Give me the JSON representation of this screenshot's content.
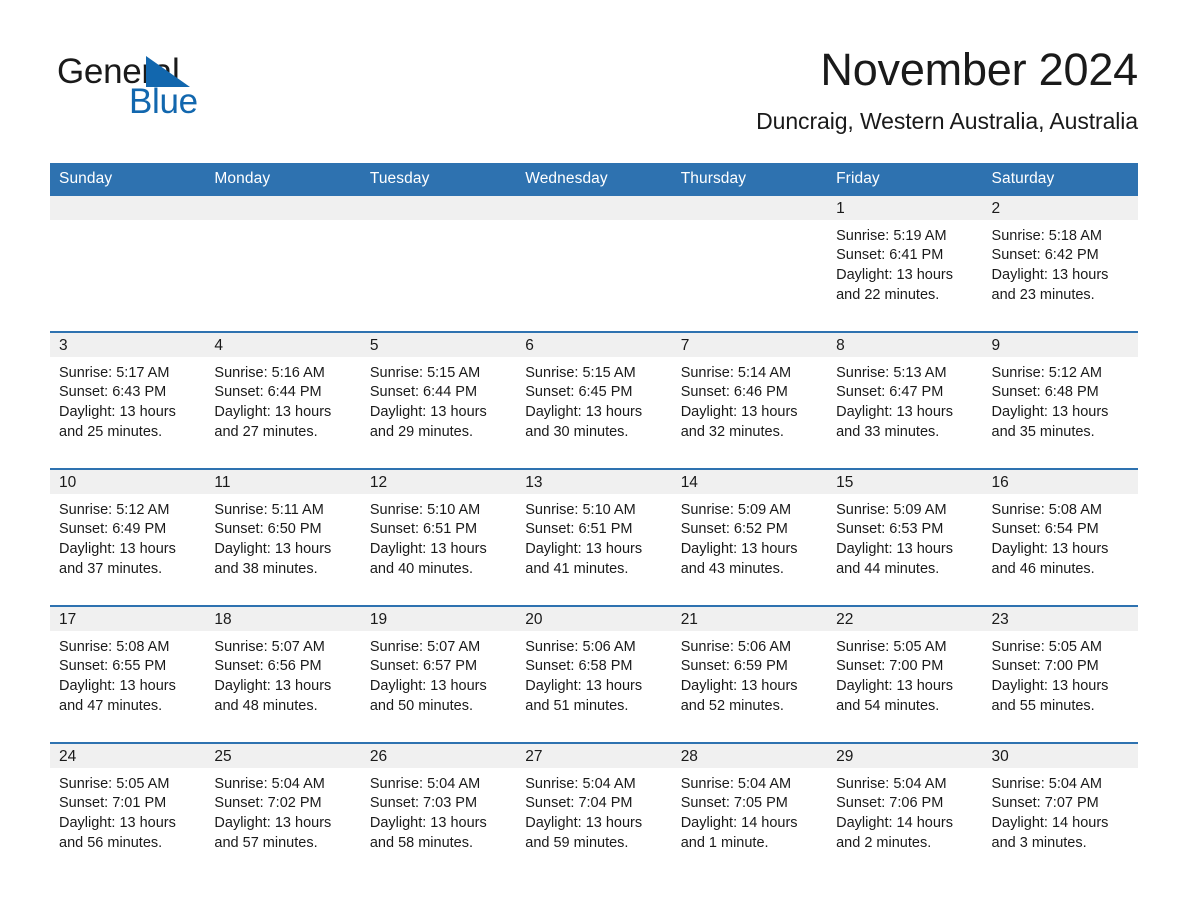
{
  "brand": {
    "word_one": "General",
    "word_two": "Blue",
    "triangle_icon": "triangle-logo-icon",
    "color": "#1267ae"
  },
  "header": {
    "month_title": "November 2024",
    "location": "Duncraig, Western Australia, Australia"
  },
  "theme": {
    "header_blue": "#2e72b0",
    "daynum_band": "#f0f0f0",
    "text": "#1a1a1a"
  },
  "calendar": {
    "weekday_headers": [
      "Sunday",
      "Monday",
      "Tuesday",
      "Wednesday",
      "Thursday",
      "Friday",
      "Saturday"
    ],
    "weeks": [
      [
        {
          "day": "",
          "empty": true
        },
        {
          "day": "",
          "empty": true
        },
        {
          "day": "",
          "empty": true
        },
        {
          "day": "",
          "empty": true
        },
        {
          "day": "",
          "empty": true
        },
        {
          "day": "1",
          "sunrise": "Sunrise: 5:19 AM",
          "sunset": "Sunset: 6:41 PM",
          "daylight": "Daylight: 13 hours and 22 minutes."
        },
        {
          "day": "2",
          "sunrise": "Sunrise: 5:18 AM",
          "sunset": "Sunset: 6:42 PM",
          "daylight": "Daylight: 13 hours and 23 minutes."
        }
      ],
      [
        {
          "day": "3",
          "sunrise": "Sunrise: 5:17 AM",
          "sunset": "Sunset: 6:43 PM",
          "daylight": "Daylight: 13 hours and 25 minutes."
        },
        {
          "day": "4",
          "sunrise": "Sunrise: 5:16 AM",
          "sunset": "Sunset: 6:44 PM",
          "daylight": "Daylight: 13 hours and 27 minutes."
        },
        {
          "day": "5",
          "sunrise": "Sunrise: 5:15 AM",
          "sunset": "Sunset: 6:44 PM",
          "daylight": "Daylight: 13 hours and 29 minutes."
        },
        {
          "day": "6",
          "sunrise": "Sunrise: 5:15 AM",
          "sunset": "Sunset: 6:45 PM",
          "daylight": "Daylight: 13 hours and 30 minutes."
        },
        {
          "day": "7",
          "sunrise": "Sunrise: 5:14 AM",
          "sunset": "Sunset: 6:46 PM",
          "daylight": "Daylight: 13 hours and 32 minutes."
        },
        {
          "day": "8",
          "sunrise": "Sunrise: 5:13 AM",
          "sunset": "Sunset: 6:47 PM",
          "daylight": "Daylight: 13 hours and 33 minutes."
        },
        {
          "day": "9",
          "sunrise": "Sunrise: 5:12 AM",
          "sunset": "Sunset: 6:48 PM",
          "daylight": "Daylight: 13 hours and 35 minutes."
        }
      ],
      [
        {
          "day": "10",
          "sunrise": "Sunrise: 5:12 AM",
          "sunset": "Sunset: 6:49 PM",
          "daylight": "Daylight: 13 hours and 37 minutes."
        },
        {
          "day": "11",
          "sunrise": "Sunrise: 5:11 AM",
          "sunset": "Sunset: 6:50 PM",
          "daylight": "Daylight: 13 hours and 38 minutes."
        },
        {
          "day": "12",
          "sunrise": "Sunrise: 5:10 AM",
          "sunset": "Sunset: 6:51 PM",
          "daylight": "Daylight: 13 hours and 40 minutes."
        },
        {
          "day": "13",
          "sunrise": "Sunrise: 5:10 AM",
          "sunset": "Sunset: 6:51 PM",
          "daylight": "Daylight: 13 hours and 41 minutes."
        },
        {
          "day": "14",
          "sunrise": "Sunrise: 5:09 AM",
          "sunset": "Sunset: 6:52 PM",
          "daylight": "Daylight: 13 hours and 43 minutes."
        },
        {
          "day": "15",
          "sunrise": "Sunrise: 5:09 AM",
          "sunset": "Sunset: 6:53 PM",
          "daylight": "Daylight: 13 hours and 44 minutes."
        },
        {
          "day": "16",
          "sunrise": "Sunrise: 5:08 AM",
          "sunset": "Sunset: 6:54 PM",
          "daylight": "Daylight: 13 hours and 46 minutes."
        }
      ],
      [
        {
          "day": "17",
          "sunrise": "Sunrise: 5:08 AM",
          "sunset": "Sunset: 6:55 PM",
          "daylight": "Daylight: 13 hours and 47 minutes."
        },
        {
          "day": "18",
          "sunrise": "Sunrise: 5:07 AM",
          "sunset": "Sunset: 6:56 PM",
          "daylight": "Daylight: 13 hours and 48 minutes."
        },
        {
          "day": "19",
          "sunrise": "Sunrise: 5:07 AM",
          "sunset": "Sunset: 6:57 PM",
          "daylight": "Daylight: 13 hours and 50 minutes."
        },
        {
          "day": "20",
          "sunrise": "Sunrise: 5:06 AM",
          "sunset": "Sunset: 6:58 PM",
          "daylight": "Daylight: 13 hours and 51 minutes."
        },
        {
          "day": "21",
          "sunrise": "Sunrise: 5:06 AM",
          "sunset": "Sunset: 6:59 PM",
          "daylight": "Daylight: 13 hours and 52 minutes."
        },
        {
          "day": "22",
          "sunrise": "Sunrise: 5:05 AM",
          "sunset": "Sunset: 7:00 PM",
          "daylight": "Daylight: 13 hours and 54 minutes."
        },
        {
          "day": "23",
          "sunrise": "Sunrise: 5:05 AM",
          "sunset": "Sunset: 7:00 PM",
          "daylight": "Daylight: 13 hours and 55 minutes."
        }
      ],
      [
        {
          "day": "24",
          "sunrise": "Sunrise: 5:05 AM",
          "sunset": "Sunset: 7:01 PM",
          "daylight": "Daylight: 13 hours and 56 minutes."
        },
        {
          "day": "25",
          "sunrise": "Sunrise: 5:04 AM",
          "sunset": "Sunset: 7:02 PM",
          "daylight": "Daylight: 13 hours and 57 minutes."
        },
        {
          "day": "26",
          "sunrise": "Sunrise: 5:04 AM",
          "sunset": "Sunset: 7:03 PM",
          "daylight": "Daylight: 13 hours and 58 minutes."
        },
        {
          "day": "27",
          "sunrise": "Sunrise: 5:04 AM",
          "sunset": "Sunset: 7:04 PM",
          "daylight": "Daylight: 13 hours and 59 minutes."
        },
        {
          "day": "28",
          "sunrise": "Sunrise: 5:04 AM",
          "sunset": "Sunset: 7:05 PM",
          "daylight": "Daylight: 14 hours and 1 minute."
        },
        {
          "day": "29",
          "sunrise": "Sunrise: 5:04 AM",
          "sunset": "Sunset: 7:06 PM",
          "daylight": "Daylight: 14 hours and 2 minutes."
        },
        {
          "day": "30",
          "sunrise": "Sunrise: 5:04 AM",
          "sunset": "Sunset: 7:07 PM",
          "daylight": "Daylight: 14 hours and 3 minutes."
        }
      ]
    ]
  }
}
